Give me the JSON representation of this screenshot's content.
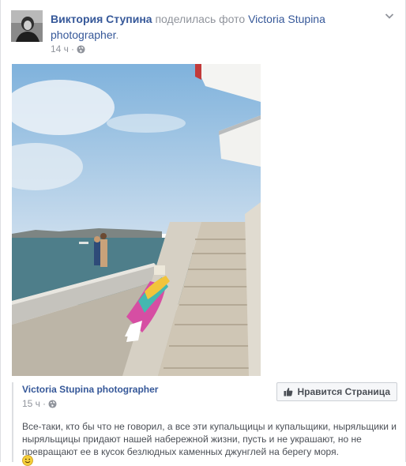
{
  "header": {
    "author": "Виктория Ступина",
    "action_text": "поделилась фото",
    "page_link": "Victoria Stupina photographer",
    "period": ".",
    "time": "14 ч",
    "dot": "·"
  },
  "icons": {
    "avatar": "profile-photo",
    "privacy": "globe-icon",
    "menu": "chevron-down-icon",
    "like": "thumbs-up-icon",
    "emoji": "smiley-icon"
  },
  "shared": {
    "page_name": "Victoria Stupina photographer",
    "time": "15 ч",
    "dot": "·",
    "like_label": "Нравится Страница",
    "text": "Все-таки, кто бы что не говорил, а все эти купальщицы и купальщики, ныряльщики и ныряльщицы придают нашей набережной жизни, пусть и не украшают, но не превращают ее в кусок безлюдных каменных джунглей на берегу моря."
  },
  "colors": {
    "link": "#365899",
    "meta": "#90949c",
    "body_text": "#4b4f56",
    "border": "#dddfe2"
  }
}
